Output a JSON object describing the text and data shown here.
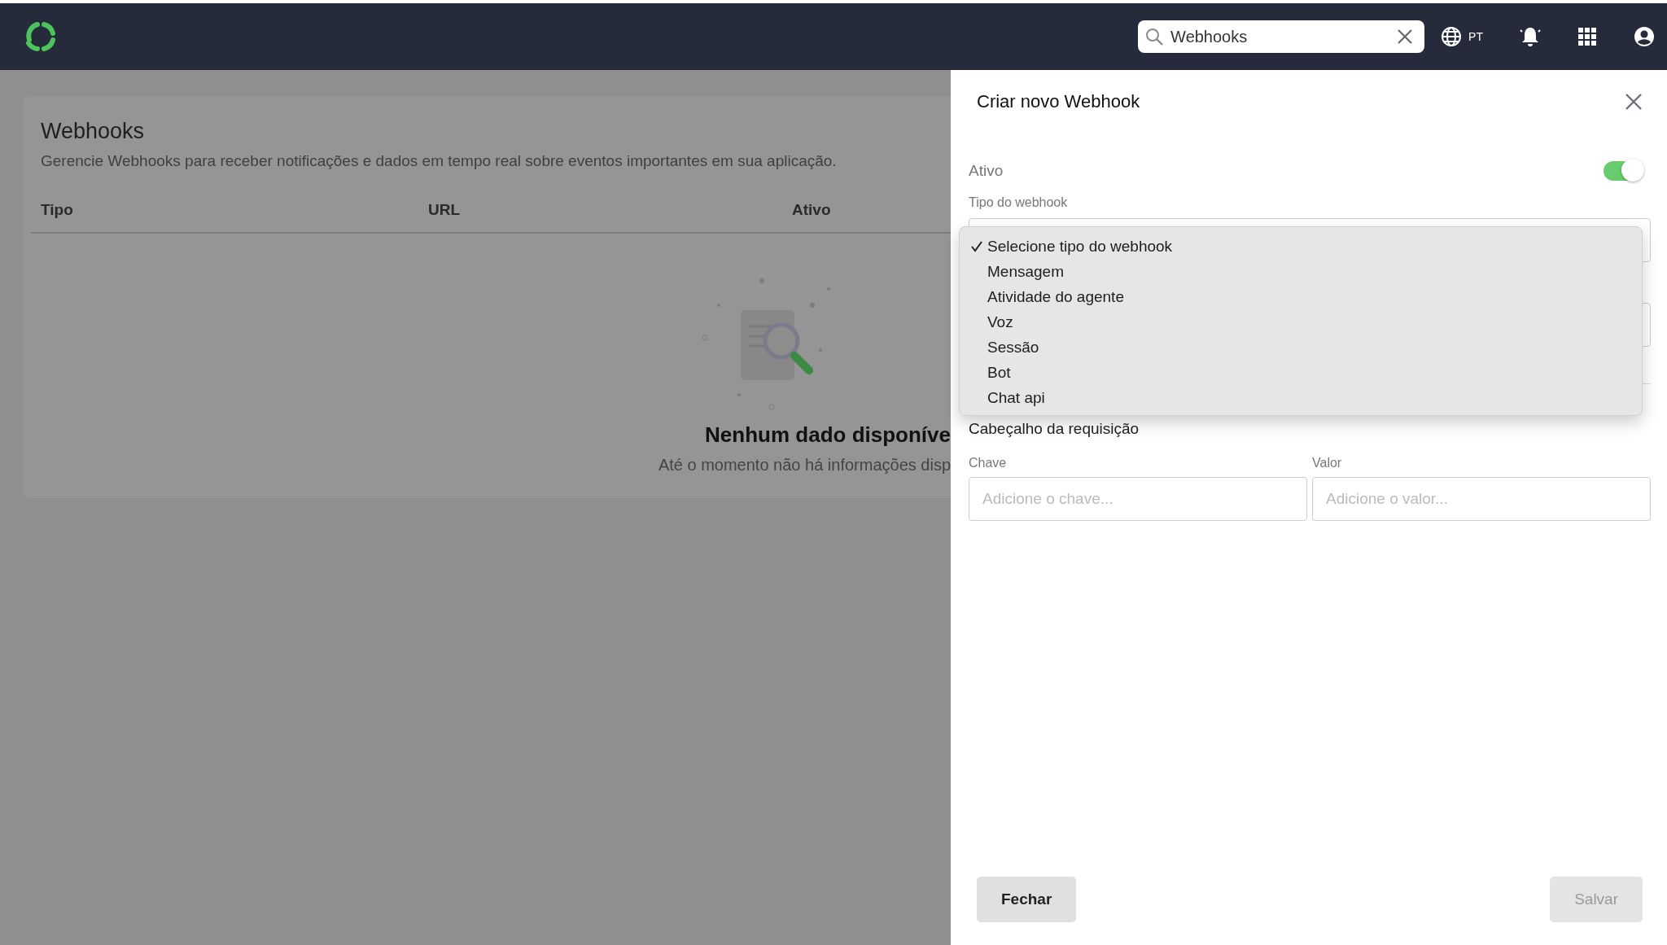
{
  "topbar": {
    "search": {
      "value": "Webhooks"
    },
    "language": "PT"
  },
  "page": {
    "title": "Webhooks",
    "description": "Gerencie Webhooks para receber notificações e dados em tempo real sobre eventos importantes em sua aplicação.",
    "table": {
      "columns": [
        "Tipo",
        "URL",
        "Ativo"
      ]
    },
    "empty_state": {
      "title": "Nenhum dado disponíve",
      "message": "Até o momento não há informações disp"
    }
  },
  "panel": {
    "title": "Criar novo Webhook",
    "active": {
      "label": "Ativo",
      "on": true
    },
    "type_field": {
      "label": "Tipo do webhook",
      "options": [
        {
          "label": "Selecione tipo do webhook",
          "selected": true
        },
        {
          "label": "Mensagem",
          "selected": false
        },
        {
          "label": "Atividade do agente",
          "selected": false
        },
        {
          "label": "Voz",
          "selected": false
        },
        {
          "label": "Sessão",
          "selected": false
        },
        {
          "label": "Bot",
          "selected": false
        },
        {
          "label": "Chat api",
          "selected": false
        }
      ]
    },
    "headers": {
      "title": "Cabeçalho da requisição",
      "key": {
        "label": "Chave",
        "placeholder": "Adicione o chave..."
      },
      "value": {
        "label": "Valor",
        "placeholder": "Adicione o valor..."
      }
    },
    "buttons": [
      {
        "label": "Fechar",
        "disabled": false
      },
      {
        "label": "Salvar",
        "disabled": true
      }
    ]
  }
}
